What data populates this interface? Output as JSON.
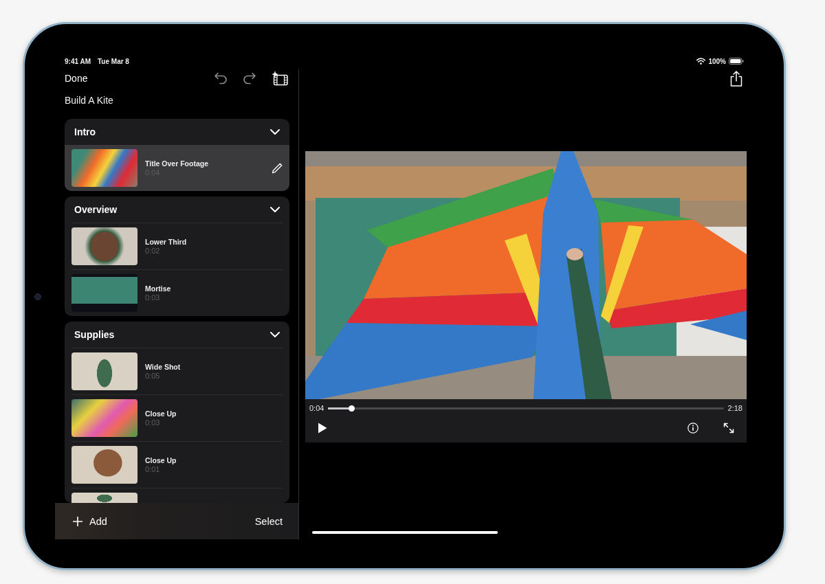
{
  "status_bar": {
    "time": "9:41 AM",
    "date": "Tue Mar 8",
    "battery": "100%"
  },
  "sidebar": {
    "done": "Done",
    "project_title": "Build A Kite",
    "sections": [
      {
        "title": "Intro",
        "expanded": true,
        "clips": [
          {
            "title": "Title Over Footage",
            "duration": "0:04",
            "selected": true
          }
        ]
      },
      {
        "title": "Overview",
        "expanded": true,
        "clips": [
          {
            "title": "Lower Third",
            "duration": "0:02",
            "selected": false
          },
          {
            "title": "Mortise",
            "duration": "0:03",
            "selected": false
          }
        ]
      },
      {
        "title": "Supplies",
        "expanded": true,
        "clips": [
          {
            "title": "Wide Shot",
            "duration": "0:05",
            "selected": false
          },
          {
            "title": "Close Up",
            "duration": "0:03",
            "selected": false
          },
          {
            "title": "Close Up",
            "duration": "0:01",
            "selected": false
          },
          {
            "selected": false
          }
        ]
      }
    ],
    "bottom_bar": {
      "add": "Add",
      "select": "Select"
    }
  },
  "player": {
    "elapsed": "0:04",
    "duration": "2:18",
    "level": 0.06,
    "playing": false
  }
}
